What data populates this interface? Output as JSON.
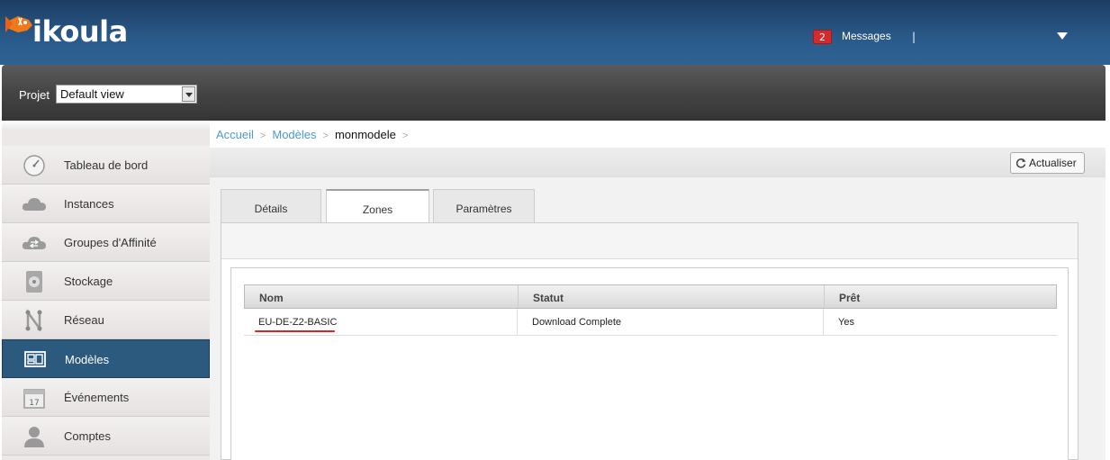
{
  "header": {
    "logo_text": "ikoula",
    "messages_count": "2",
    "messages_label": "Messages",
    "separator": "|"
  },
  "project": {
    "label": "Projet",
    "selected": "Default view"
  },
  "sidebar": {
    "items": [
      {
        "label": "Tableau de bord",
        "icon": "dashboard-gauge-icon"
      },
      {
        "label": "Instances",
        "icon": "cloud-icon"
      },
      {
        "label": "Groupes d'Affinité",
        "icon": "cloud-sync-icon"
      },
      {
        "label": "Stockage",
        "icon": "disk-icon"
      },
      {
        "label": "Réseau",
        "icon": "network-icon"
      },
      {
        "label": "Modèles",
        "icon": "templates-icon",
        "active": true
      },
      {
        "label": "Événements",
        "icon": "calendar-icon"
      },
      {
        "label": "Comptes",
        "icon": "user-icon"
      }
    ]
  },
  "breadcrumb": {
    "items": [
      "Accueil",
      "Modèles",
      "monmodele"
    ],
    "separator": ">"
  },
  "toolbar": {
    "refresh_label": "Actualiser"
  },
  "tabs": [
    {
      "label": "Détails"
    },
    {
      "label": "Zones",
      "active": true
    },
    {
      "label": "Paramètres"
    }
  ],
  "table": {
    "columns": [
      "Nom",
      "Statut",
      "Prêt"
    ],
    "rows": [
      [
        "EU-DE-Z2-BASIC",
        "Download Complete",
        "Yes"
      ]
    ]
  },
  "colors": {
    "header_blue": "#2a5a8a",
    "active_sidebar": "#2b5a7e",
    "link_blue": "#4a9bd1",
    "badge_red": "#d32b2b",
    "annotation_red": "#dd2222"
  }
}
